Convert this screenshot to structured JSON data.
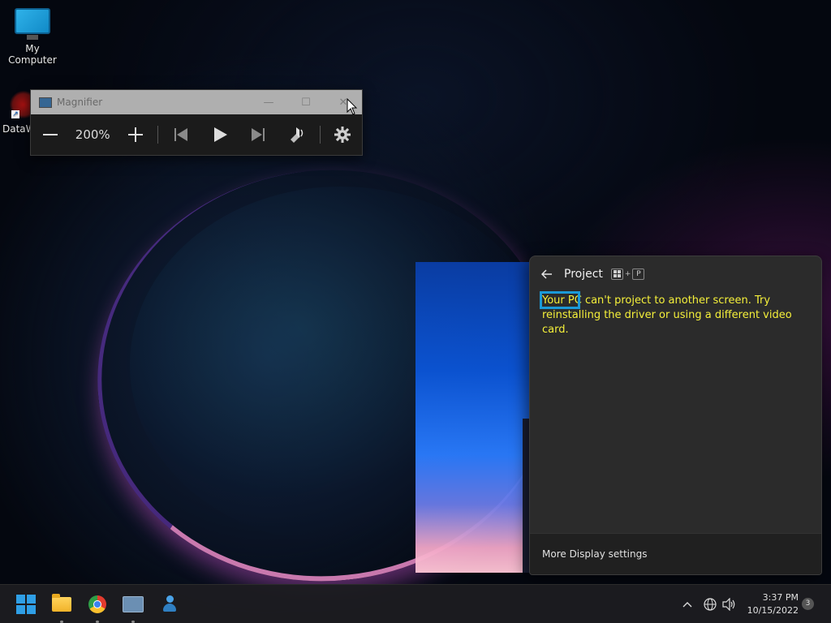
{
  "desktop": {
    "icons": [
      {
        "label": "My Computer"
      },
      {
        "label": "DataW"
      }
    ]
  },
  "magnifier": {
    "title": "Magnifier",
    "zoom_level": "200%",
    "controls": {
      "minimize": "—",
      "maximize": "☐",
      "close": "✕"
    }
  },
  "project_panel": {
    "title": "Project",
    "shortcut_key": "P",
    "shortcut_plus": "+",
    "message_highlight": "Your PC",
    "message_rest": " can't project to another screen. Try reinstalling the driver or using a different video card.",
    "footer_link": "More Display settings"
  },
  "taskbar": {
    "clock_time": "3:37 PM",
    "clock_date": "10/15/2022",
    "notification_count": "3"
  },
  "colors": {
    "message_text": "#f5f03a",
    "highlight_border": "#1b9ad8",
    "start_blue": "#2f9fe6"
  }
}
